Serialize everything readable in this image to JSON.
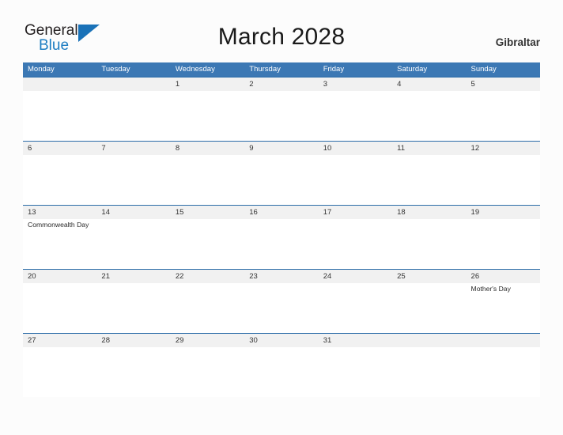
{
  "brand": {
    "name_part1": "General",
    "name_part2": "Blue",
    "triangle_color": "#1a72b8",
    "blue_text_color": "#1c7cc1"
  },
  "header": {
    "title": "March 2028",
    "location": "Gibraltar"
  },
  "colors": {
    "header_blue": "#3c78b4",
    "row_divider_blue": "#2b6ca8",
    "date_band_gray": "#f1f1f1",
    "page_background": "#fcfcfc"
  },
  "calendar": {
    "month": "March",
    "year": "2028",
    "weekdays": [
      "Monday",
      "Tuesday",
      "Wednesday",
      "Thursday",
      "Friday",
      "Saturday",
      "Sunday"
    ],
    "weeks": [
      {
        "dates": [
          "",
          "",
          "1",
          "2",
          "3",
          "4",
          "5"
        ],
        "events": [
          "",
          "",
          "",
          "",
          "",
          "",
          ""
        ]
      },
      {
        "dates": [
          "6",
          "7",
          "8",
          "9",
          "10",
          "11",
          "12"
        ],
        "events": [
          "",
          "",
          "",
          "",
          "",
          "",
          ""
        ]
      },
      {
        "dates": [
          "13",
          "14",
          "15",
          "16",
          "17",
          "18",
          "19"
        ],
        "events": [
          "Commonwealth Day",
          "",
          "",
          "",
          "",
          "",
          ""
        ]
      },
      {
        "dates": [
          "20",
          "21",
          "22",
          "23",
          "24",
          "25",
          "26"
        ],
        "events": [
          "",
          "",
          "",
          "",
          "",
          "",
          "Mother's Day"
        ]
      },
      {
        "dates": [
          "27",
          "28",
          "29",
          "30",
          "31",
          "",
          ""
        ],
        "events": [
          "",
          "",
          "",
          "",
          "",
          "",
          ""
        ]
      }
    ]
  }
}
